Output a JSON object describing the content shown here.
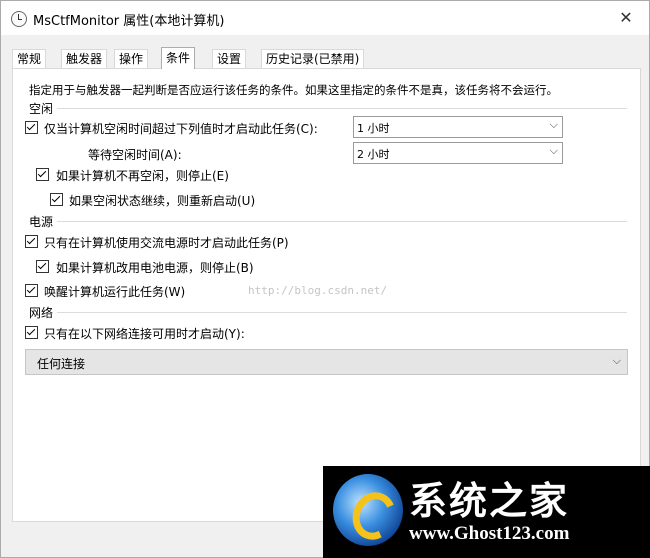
{
  "window": {
    "title": "MsCtfMonitor 属性(本地计算机)",
    "close_glyph": "✕"
  },
  "tabs": [
    {
      "label": "常规"
    },
    {
      "label": "触发器"
    },
    {
      "label": "操作"
    },
    {
      "label": "条件",
      "active": true
    },
    {
      "label": "设置"
    },
    {
      "label": "历史记录(已禁用)"
    }
  ],
  "description": "指定用于与触发器一起判断是否应运行该任务的条件。如果这里指定的条件不是真，该任务将不会运行。",
  "idle": {
    "group_label": "空闲",
    "start_if_idle": {
      "label": "仅当计算机空闲时间超过下列值时才启动此任务(C):",
      "checked": true
    },
    "idle_duration": {
      "value": "1 小时"
    },
    "wait_label": "等待空闲时间(A):",
    "wait_duration": {
      "value": "2 小时"
    },
    "stop_if_not_idle": {
      "label": "如果计算机不再空闲，则停止(E)",
      "checked": true
    },
    "restart_if_idle": {
      "label": "如果空闲状态继续，则重新启动(U)",
      "checked": true
    }
  },
  "power": {
    "group_label": "电源",
    "ac_only": {
      "label": "只有在计算机使用交流电源时才启动此任务(P)",
      "checked": true
    },
    "stop_on_battery": {
      "label": "如果计算机改用电池电源，则停止(B)",
      "checked": true
    },
    "wake_to_run": {
      "label": "唤醒计算机运行此任务(W)",
      "checked": true
    }
  },
  "network": {
    "group_label": "网络",
    "only_if_network": {
      "label": "只有在以下网络连接可用时才启动(Y):",
      "checked": true
    },
    "connection": {
      "value": "任何连接"
    }
  },
  "watermark": "http://blog.csdn.net/",
  "logo": {
    "title": "系统之家",
    "url": "www.Ghost123.com"
  },
  "icons": {
    "chevron": "⌵"
  }
}
